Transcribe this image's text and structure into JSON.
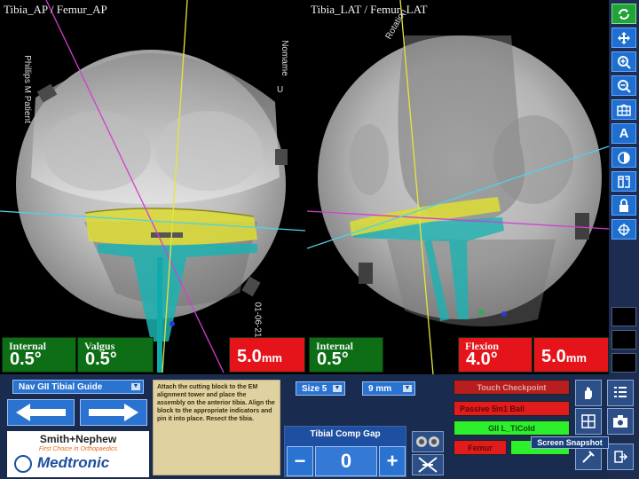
{
  "views": {
    "ap": {
      "title": "Tibia_AP / Femur_AP",
      "side_text": "Phillips M Patient",
      "side_text_2": "Nomame",
      "side_text_3": "U",
      "date_text": "01-06-21"
    },
    "lat": {
      "title": "Tibia_LAT / Femur_LAT",
      "side_text": "Rotation"
    }
  },
  "readouts": {
    "ap_rotation": {
      "label": "Internal",
      "value": "0.5°"
    },
    "ap_varus": {
      "label": "Valgus",
      "value": "0.5°"
    },
    "ap_resection": {
      "value": "5.0",
      "unit": "mm"
    },
    "lat_rotation": {
      "label": "Internal",
      "value": "0.5°"
    },
    "lat_flexion": {
      "label": "Flexion",
      "value": "4.0°"
    },
    "lat_resection": {
      "value": "5.0",
      "unit": "mm"
    }
  },
  "toolbar": {
    "tools": [
      "refresh-icon",
      "pan-icon",
      "zoom-in-icon",
      "zoom-out-icon",
      "grid-icon",
      "annotate-icon",
      "contrast-icon",
      "flip-icon",
      "lock-icon",
      "crosshair-icon"
    ],
    "annotate_glyph": "A"
  },
  "bottom": {
    "guide_dropdown": "Nav GII Tibial Guide",
    "instructions": "Attach the cutting block to the EM alignment tower and place the assembly on the anterior tibia. Align the block to the appropriate indicators and pin it into place. Resect the tibia.",
    "size_dropdown": "Size 5",
    "depth_dropdown": "9 mm",
    "gap_title": "Tibial Comp Gap",
    "gap_value": "0",
    "gap_minus": "−",
    "gap_plus": "+",
    "touch_checkpoint": "Touch Checkpoint",
    "status_1": "Passive 5in1 Ball",
    "status_2": "GII L_TiCold",
    "status_3": "Femur",
    "tooltip": "Screen Snapshot",
    "logo_brand": "Smith+Nephew",
    "logo_tagline": "First Choice in Orthopaedics",
    "logo_partner": "Medtronic"
  },
  "colors": {
    "readout_green": "#0d6e16",
    "readout_red": "#e5141b",
    "button_blue": "#2a73d1",
    "status_green": "#2bf02b"
  }
}
